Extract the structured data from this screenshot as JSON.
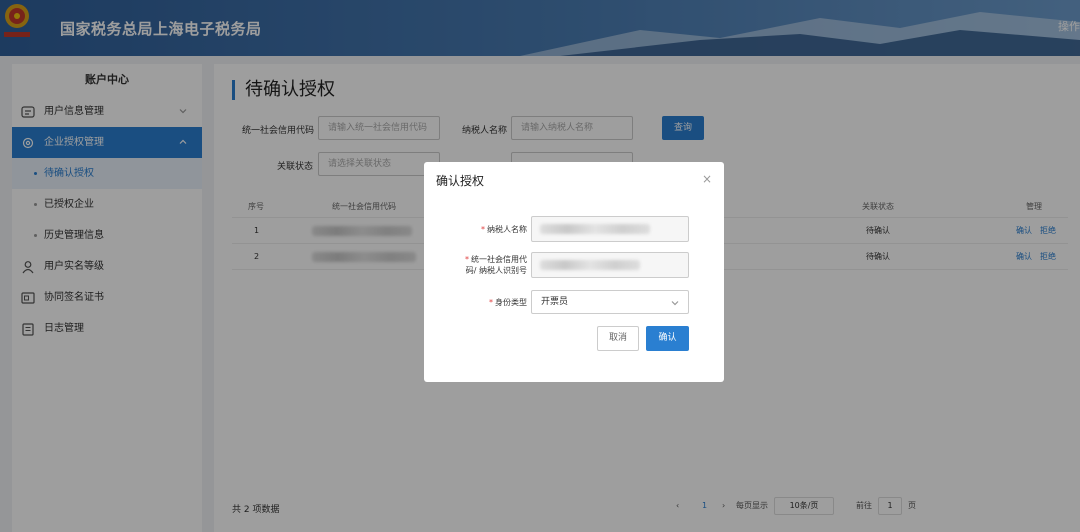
{
  "header": {
    "site_title": "国家税务总局上海电子税务局",
    "right_text": "操作",
    "logo_icon": "tax-emblem-icon"
  },
  "sidebar": {
    "title": "账户中心",
    "items": [
      {
        "label": "用户信息管理",
        "icon": "user-card-icon",
        "expanded": false
      },
      {
        "label": "企业授权管理",
        "icon": "gear-icon",
        "expanded": true
      },
      {
        "label": "用户实名等级",
        "icon": "person-icon"
      },
      {
        "label": "协同签名证书",
        "icon": "certificate-icon"
      },
      {
        "label": "日志管理",
        "icon": "log-icon"
      }
    ],
    "subitems": [
      {
        "label": "待确认授权"
      },
      {
        "label": "已授权企业"
      },
      {
        "label": "历史管理信息"
      }
    ]
  },
  "main": {
    "title": "待确认授权",
    "filters": {
      "credit_code_label": "统一社会信用代码",
      "credit_code_placeholder": "请输入统一社会信用代码",
      "taxpayer_name_label": "纳税人名称",
      "taxpayer_name_placeholder": "请输入纳税人名称",
      "relation_status_label": "关联状态",
      "relation_status_placeholder": "请选择关联状态",
      "query_button": "查询"
    },
    "table": {
      "headers": [
        "序号",
        "统一社会信用代码",
        "关联状态",
        "管理"
      ],
      "rows": [
        {
          "index": "1",
          "status": "待确认",
          "actions": [
            "确认",
            "拒绝"
          ]
        },
        {
          "index": "2",
          "status": "待确认",
          "actions": [
            "确认",
            "拒绝"
          ]
        }
      ]
    },
    "footer": {
      "total": "共 2 项数据",
      "current_page": "1",
      "per_page_label": "每页显示",
      "per_page_value": "10条/页",
      "goto_label": "前往",
      "goto_value": "1",
      "page_unit": "页"
    }
  },
  "modal": {
    "title": "确认授权",
    "close": "×",
    "fields": {
      "taxpayer_name_label": "纳税人名称",
      "credit_code_label_line1": "统一社会信用代",
      "credit_code_label_line2": "码/ 纳税人识别号",
      "identity_type_label": "身份类型",
      "identity_type_value": "开票员"
    },
    "cancel": "取消",
    "confirm": "确认"
  },
  "colors": {
    "primary": "#2a7fd1",
    "header_bg": "#3b6ea8",
    "required": "#e04040"
  }
}
